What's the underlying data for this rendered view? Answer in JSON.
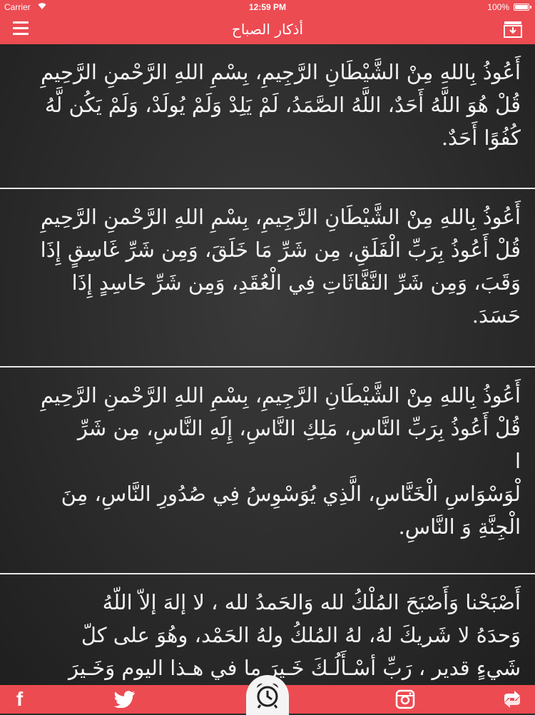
{
  "status_bar": {
    "carrier": "Carrier",
    "time": "12:59 PM",
    "battery": "100%"
  },
  "nav": {
    "title": "أذكار الصباح",
    "menu_icon": "hamburger-menu-icon",
    "download_icon": "download-icon"
  },
  "adhkar": [
    "أَعُوذُ بِاللهِ مِنْ الشَّيْطَانِ الرَّجِيمِ، بِسْمِ اللهِ الرَّحْمنِ الرَّحِيمِ\nقُلْ هُوَ اللَّهُ أَحَدٌ، اللَّهُ الصَّمَدُ، لَمْ يَلِدْ وَلَمْ يُولَدْ، وَلَمْ يَكُن لَّهُ\nكُفُوًا أَحَدٌ.",
    "أَعُوذُ بِاللهِ مِنْ الشَّيْطَانِ الرَّجِيمِ، بِسْمِ اللهِ الرَّحْمنِ الرَّحِيمِ\nقُلْ أَعُوذُ بِرَبِّ الْفَلَقِ، مِن شَرِّ مَا خَلَقَ، وَمِن شَرِّ غَاسِقٍ إِذَا\nوَقَبَ، وَمِن شَرِّ النَّفَّاثَاتِ فِي الْعُقَدِ، وَمِن شَرِّ حَاسِدٍ إِذَا\nحَسَدَ.",
    "أَعُوذُ بِاللهِ مِنْ الشَّيْطَانِ الرَّجِيمِ، بِسْمِ اللهِ الرَّحْمنِ الرَّحِيمِ\nقُلْ أَعُوذُ بِرَبِّ النَّاسِ، مَلِكِ النَّاسِ، إِلَهِ النَّاسِ، مِن شَرِّ\nا\nلْوَسْوَاسِ الْخَنَّاسِ، الَّذِي يُوَسْوِسُ فِي صُدُورِ النَّاسِ، مِنَ\nالْجِنَّةِ وَ النَّاسِ.",
    "أَصْبَحْنا وَأَصْبَحَ المُلْكُ لله وَالحَمدُ لله ، لا إلهَ إلاّ اللّهُ\nوَحدَهُ لا شَريكَ لهُ، لهُ المُلكُ ولهُ الحَمْد، وهُوَ على كلّ\nشَيءٍ قدير ، رَبِّ أسْـأَلُـكَ خَـيرَ ما في هـذا اليوم وَخَـيرَ"
  ],
  "tabbar": {
    "facebook_icon": "facebook-icon",
    "facebook_glyph": "f",
    "twitter_icon": "twitter-icon",
    "alarm_icon": "alarm-clock-icon",
    "instagram_icon": "instagram-icon",
    "share_icon": "share-icon"
  },
  "colors": {
    "accent": "#ec4b52",
    "background": "#2b2b2b",
    "text": "#f3f3f3"
  }
}
